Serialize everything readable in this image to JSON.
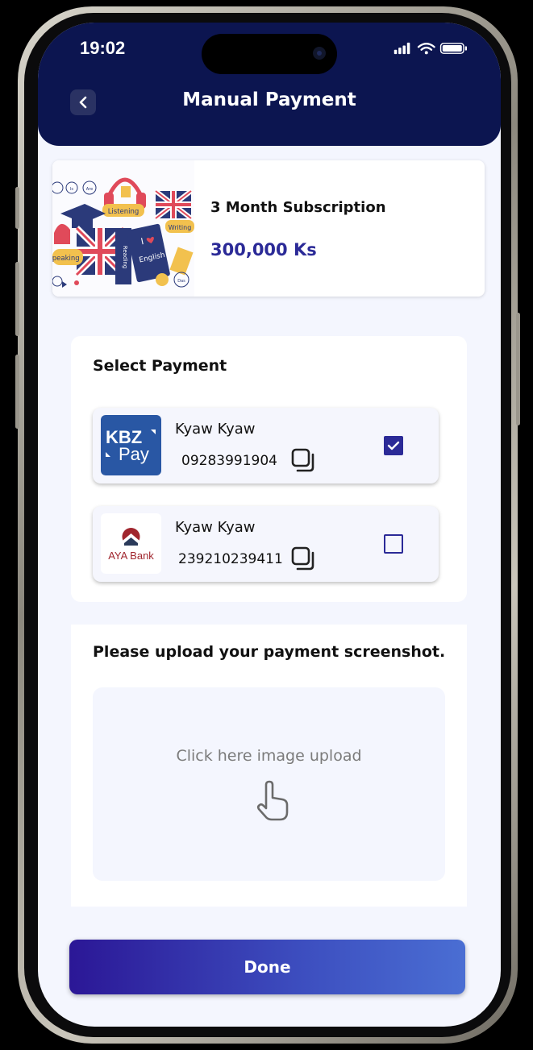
{
  "status_bar": {
    "time": "19:02"
  },
  "header": {
    "title": "Manual Payment"
  },
  "subscription": {
    "name": "3 Month Subscription",
    "price": "300,000 Ks",
    "image_labels": [
      "Listening",
      "Writing",
      "Speaking",
      "Reading",
      "English",
      "I",
      "Are",
      "Is",
      "Das",
      "Tres"
    ]
  },
  "payment": {
    "section_title": "Select Payment",
    "methods": [
      {
        "logo_text_top": "KBZ",
        "logo_text_bottom": "Pay",
        "name": "Kyaw Kyaw",
        "number": "09283991904",
        "selected": true,
        "icon": "kbzpay-logo"
      },
      {
        "logo_text": "AYA Bank",
        "name": "Kyaw Kyaw",
        "number": "239210239411",
        "selected": false,
        "icon": "aya-bank-logo"
      }
    ]
  },
  "upload": {
    "title": "Please upload your payment screenshot.",
    "placeholder": "Click here image upload",
    "icon": "pointer-hand-icon"
  },
  "actions": {
    "done_label": "Done"
  },
  "colors": {
    "header_bg": "#0c1550",
    "accent": "#2b2a97",
    "kbz_blue": "#2957a4",
    "aya_red": "#a0262e"
  }
}
